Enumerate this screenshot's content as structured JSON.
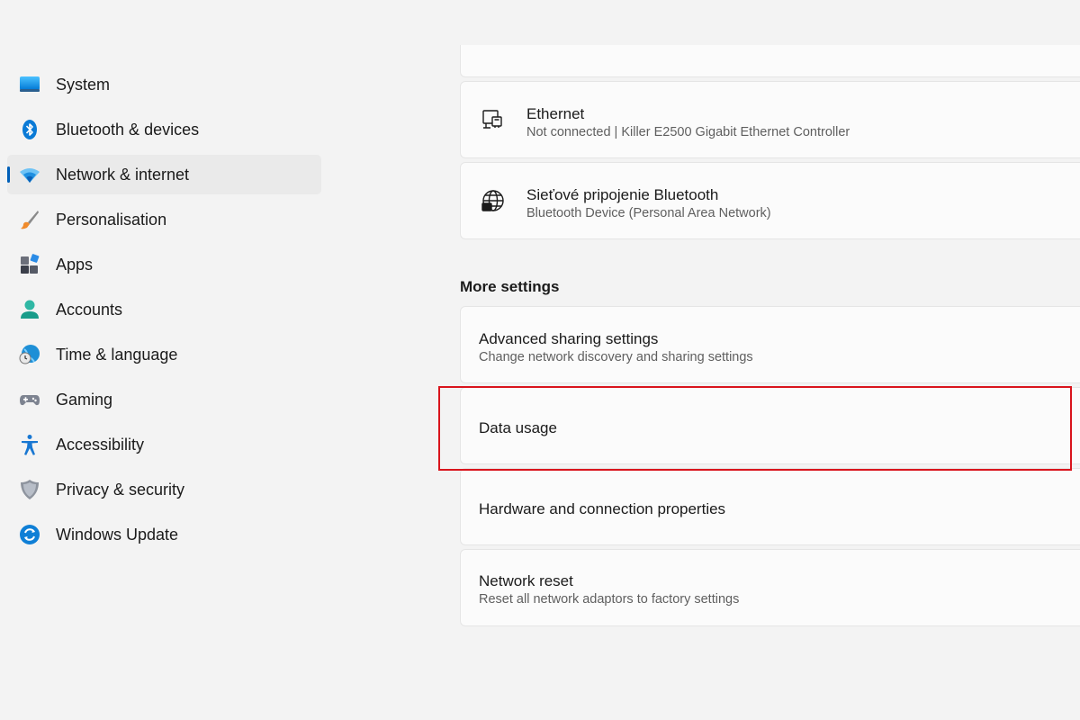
{
  "sidebar": {
    "items": [
      {
        "label": "System",
        "icon": "monitor-icon"
      },
      {
        "label": "Bluetooth & devices",
        "icon": "bluetooth-icon"
      },
      {
        "label": "Network & internet",
        "icon": "wifi-icon",
        "active": true
      },
      {
        "label": "Personalisation",
        "icon": "brush-icon"
      },
      {
        "label": "Apps",
        "icon": "apps-icon"
      },
      {
        "label": "Accounts",
        "icon": "person-icon"
      },
      {
        "label": "Time & language",
        "icon": "globe-clock-icon"
      },
      {
        "label": "Gaming",
        "icon": "gamepad-icon"
      },
      {
        "label": "Accessibility",
        "icon": "accessibility-icon"
      },
      {
        "label": "Privacy & security",
        "icon": "shield-icon"
      },
      {
        "label": "Windows Update",
        "icon": "update-icon"
      }
    ]
  },
  "network_cards": [
    {
      "title": "Ethernet",
      "subtitle": "Not connected | Killer E2500 Gigabit Ethernet Controller",
      "icon": "ethernet-icon"
    },
    {
      "title": "Sieťové pripojenie Bluetooth",
      "subtitle": "Bluetooth Device (Personal Area Network)",
      "icon": "network-globe-icon"
    }
  ],
  "more_settings": {
    "heading": "More settings",
    "items": [
      {
        "title": "Advanced sharing settings",
        "subtitle": "Change network discovery and sharing settings"
      },
      {
        "title": "Data usage",
        "highlighted": true
      },
      {
        "title": "Hardware and connection properties"
      },
      {
        "title": "Network reset",
        "subtitle": "Reset all network adaptors to factory settings"
      }
    ]
  },
  "colors": {
    "accent": "#005fb8",
    "highlight_border": "#d9141c",
    "background": "#f3f3f3",
    "card": "#fbfbfb"
  }
}
